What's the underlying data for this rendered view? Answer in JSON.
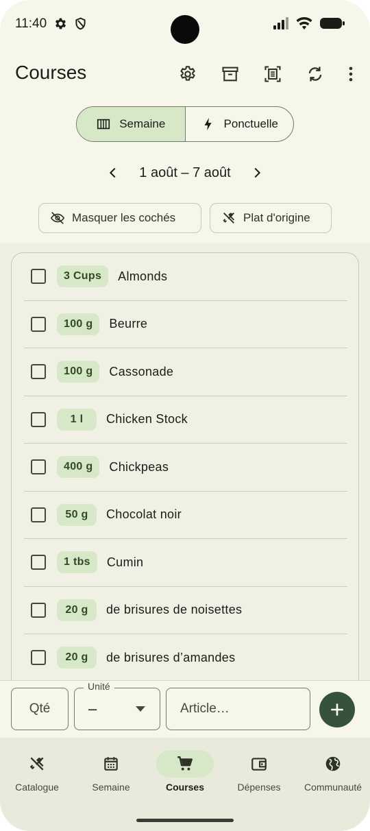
{
  "status_bar": {
    "time": "11:40"
  },
  "app_bar": {
    "title": "Courses"
  },
  "segments": [
    {
      "label": "Semaine",
      "selected": true
    },
    {
      "label": "Ponctuelle",
      "selected": false
    }
  ],
  "week": {
    "label": "1 août – 7 août"
  },
  "chips": {
    "hide_checked": "Masquer les cochés",
    "origin_dish": "Plat d'origine"
  },
  "items": [
    {
      "qty": "3 Cups",
      "name": "Almonds"
    },
    {
      "qty": "100 g",
      "name": "Beurre"
    },
    {
      "qty": "100 g",
      "name": "Cassonade"
    },
    {
      "qty": "1 l",
      "name": "Chicken Stock"
    },
    {
      "qty": "400 g",
      "name": "Chickpeas"
    },
    {
      "qty": "50 g",
      "name": "Chocolat noir"
    },
    {
      "qty": "1 tbs",
      "name": "Cumin"
    },
    {
      "qty": "20 g",
      "name": "de brisures de noisettes"
    },
    {
      "qty": "20 g",
      "name": "de brisures d’amandes"
    }
  ],
  "input": {
    "qty_placeholder": "Qté",
    "unit_label": "Unité",
    "unit_value": "–",
    "article_placeholder": "Article…"
  },
  "nav": [
    {
      "label": "Catalogue",
      "icon": "fork-knife-icon",
      "active": false
    },
    {
      "label": "Semaine",
      "icon": "calendar-icon",
      "active": false
    },
    {
      "label": "Courses",
      "icon": "cart-icon",
      "active": true
    },
    {
      "label": "Dépenses",
      "icon": "wallet-icon",
      "active": false
    },
    {
      "label": "Communauté",
      "icon": "globe-icon",
      "active": false
    }
  ],
  "colors": {
    "accent": "#d7e8c8",
    "fab": "#36523a",
    "background": "#f6f6ea"
  }
}
